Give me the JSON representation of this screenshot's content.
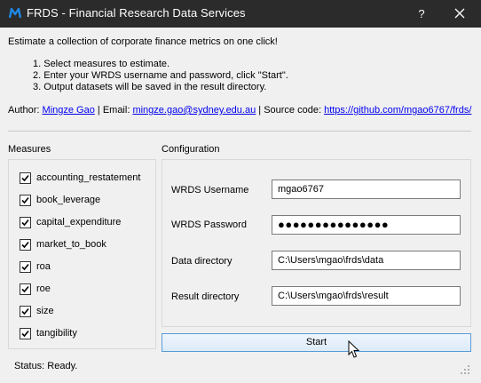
{
  "window": {
    "title": "FRDS - Financial Research Data Services",
    "help_glyph": "?",
    "accent": "#1e88e5"
  },
  "intro": "Estimate a collection of corporate finance metrics on one click!",
  "steps": [
    "1. Select measures to estimate.",
    "2. Enter your WRDS username and password, click \"Start\".",
    "3. Output datasets will be saved in the result directory."
  ],
  "author": {
    "prefix": "Author: ",
    "name": "Mingze Gao",
    "email_prefix": " | Email: ",
    "email": "mingze.gao@sydney.edu.au",
    "source_prefix": " | Source code: ",
    "source": "https://github.com/mgao6767/frds/"
  },
  "measures": {
    "title": "Measures",
    "items": [
      {
        "label": "accounting_restatement",
        "checked": true
      },
      {
        "label": "book_leverage",
        "checked": true
      },
      {
        "label": "capital_expenditure",
        "checked": true
      },
      {
        "label": "market_to_book",
        "checked": true
      },
      {
        "label": "roa",
        "checked": true
      },
      {
        "label": "roe",
        "checked": true
      },
      {
        "label": "size",
        "checked": true
      },
      {
        "label": "tangibility",
        "checked": true
      }
    ]
  },
  "config": {
    "title": "Configuration",
    "username_label": "WRDS Username",
    "username_value": "mgao6767",
    "password_label": "WRDS Password",
    "password_value": "●●●●●●●●●●●●●●●",
    "data_dir_label": "Data directory",
    "data_dir_value": "C:\\Users\\mgao\\frds\\data",
    "result_dir_label": "Result directory",
    "result_dir_value": "C:\\Users\\mgao\\frds\\result"
  },
  "start_label": "Start",
  "status": "Status: Ready."
}
